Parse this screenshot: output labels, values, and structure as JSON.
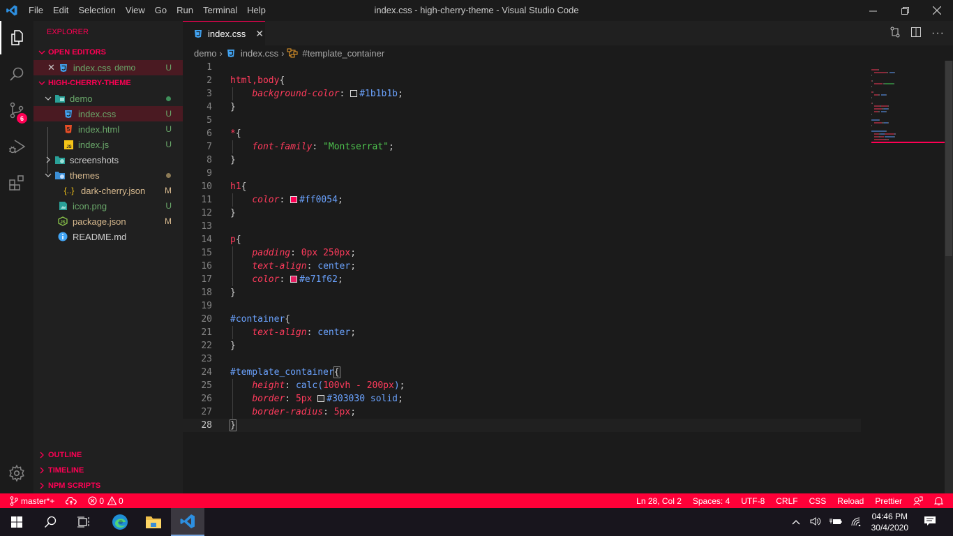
{
  "titlebar": {
    "menu": [
      "File",
      "Edit",
      "Selection",
      "View",
      "Go",
      "Run",
      "Terminal",
      "Help"
    ],
    "title": "index.css - high-cherry-theme - Visual Studio Code",
    "controls": [
      "minimize",
      "restore",
      "close"
    ]
  },
  "activity_bar": {
    "items": [
      {
        "name": "explorer",
        "active": true
      },
      {
        "name": "search"
      },
      {
        "name": "source-control",
        "badge": "6"
      },
      {
        "name": "run-debug"
      },
      {
        "name": "extensions"
      }
    ],
    "bottom": "manage"
  },
  "sidebar": {
    "title": "EXPLORER",
    "open_editors": {
      "label": "OPEN EDITORS",
      "items": [
        {
          "name": "index.css",
          "desc": "demo",
          "status": "U"
        }
      ]
    },
    "project": {
      "label": "HIGH-CHERRY-THEME",
      "tree": [
        {
          "name": "demo",
          "type": "folder",
          "expanded": true,
          "depth": 0,
          "dot": "#3f8f5a"
        },
        {
          "name": "index.css",
          "type": "css",
          "depth": 1,
          "status": "U",
          "selected": true
        },
        {
          "name": "index.html",
          "type": "html",
          "depth": 1,
          "status": "U"
        },
        {
          "name": "index.js",
          "type": "js",
          "depth": 1,
          "status": "U"
        },
        {
          "name": "screenshots",
          "type": "folder",
          "expanded": false,
          "depth": 0
        },
        {
          "name": "themes",
          "type": "folder",
          "expanded": true,
          "depth": 0,
          "dot": "#8c7a55"
        },
        {
          "name": "dark-cherry.json",
          "type": "json",
          "depth": 1,
          "status": "M"
        },
        {
          "name": "icon.png",
          "type": "png",
          "depth": 0,
          "status": "U"
        },
        {
          "name": "package.json",
          "type": "npm",
          "depth": 0,
          "status": "M"
        },
        {
          "name": "README.md",
          "type": "info",
          "depth": 0
        }
      ]
    },
    "bottom_sections": [
      "OUTLINE",
      "TIMELINE",
      "NPM SCRIPTS"
    ]
  },
  "tabs": [
    {
      "label": "index.css",
      "active": true
    }
  ],
  "breadcrumb": [
    "demo",
    "index.css",
    "#template_container"
  ],
  "editor": {
    "current_line": 28,
    "lines": [
      [],
      [
        [
          "sel",
          "html,body"
        ],
        [
          "punc",
          "{"
        ]
      ],
      [
        [
          "ind",
          "    "
        ],
        [
          "prop",
          "background-color"
        ],
        [
          "punc",
          ": "
        ],
        [
          "swatch",
          "#1b1b1b"
        ],
        [
          "val",
          "#1b1b1b"
        ],
        [
          "punc",
          ";"
        ]
      ],
      [
        [
          "punc",
          "}"
        ]
      ],
      [],
      [
        [
          "sel",
          "*"
        ],
        [
          "punc",
          "{"
        ]
      ],
      [
        [
          "ind",
          "    "
        ],
        [
          "prop",
          "font-family"
        ],
        [
          "punc",
          ": "
        ],
        [
          "str",
          "\"Montserrat\""
        ],
        [
          "punc",
          ";"
        ]
      ],
      [
        [
          "punc",
          "}"
        ]
      ],
      [],
      [
        [
          "sel",
          "h1"
        ],
        [
          "punc",
          "{"
        ]
      ],
      [
        [
          "ind",
          "    "
        ],
        [
          "prop",
          "color"
        ],
        [
          "punc",
          ": "
        ],
        [
          "swatch",
          "#ff0054"
        ],
        [
          "val",
          "#ff0054"
        ],
        [
          "punc",
          ";"
        ]
      ],
      [
        [
          "punc",
          "}"
        ]
      ],
      [],
      [
        [
          "sel",
          "p"
        ],
        [
          "punc",
          "{"
        ]
      ],
      [
        [
          "ind",
          "    "
        ],
        [
          "prop",
          "padding"
        ],
        [
          "punc",
          ": "
        ],
        [
          "num",
          "0px 250px"
        ],
        [
          "punc",
          ";"
        ]
      ],
      [
        [
          "ind",
          "    "
        ],
        [
          "prop",
          "text-align"
        ],
        [
          "punc",
          ": "
        ],
        [
          "val",
          "center"
        ],
        [
          "punc",
          ";"
        ]
      ],
      [
        [
          "ind",
          "    "
        ],
        [
          "prop",
          "color"
        ],
        [
          "punc",
          ": "
        ],
        [
          "swatch",
          "#e71f62"
        ],
        [
          "val",
          "#e71f62"
        ],
        [
          "punc",
          ";"
        ]
      ],
      [
        [
          "punc",
          "}"
        ]
      ],
      [],
      [
        [
          "idsel",
          "#container"
        ],
        [
          "punc",
          "{"
        ]
      ],
      [
        [
          "ind",
          "    "
        ],
        [
          "prop",
          "text-align"
        ],
        [
          "punc",
          ": "
        ],
        [
          "val",
          "center"
        ],
        [
          "punc",
          ";"
        ]
      ],
      [
        [
          "punc",
          "}"
        ]
      ],
      [],
      [
        [
          "idsel",
          "#template_container"
        ],
        [
          "match",
          "{"
        ]
      ],
      [
        [
          "ind",
          "    "
        ],
        [
          "prop",
          "height"
        ],
        [
          "punc",
          ": "
        ],
        [
          "val",
          "calc("
        ],
        [
          "num",
          "100vh - 200px"
        ],
        [
          "val",
          ")"
        ],
        [
          "punc",
          ";"
        ]
      ],
      [
        [
          "ind",
          "    "
        ],
        [
          "prop",
          "border"
        ],
        [
          "punc",
          ": "
        ],
        [
          "num",
          "5px "
        ],
        [
          "swatch",
          "#303030"
        ],
        [
          "val",
          "#303030 solid"
        ],
        [
          "punc",
          ";"
        ]
      ],
      [
        [
          "ind",
          "    "
        ],
        [
          "prop",
          "border-radius"
        ],
        [
          "punc",
          ": "
        ],
        [
          "num",
          "5px"
        ],
        [
          "punc",
          ";"
        ]
      ],
      [
        [
          "match",
          "}"
        ]
      ]
    ]
  },
  "statusbar": {
    "branch": "master*+",
    "errors": "0",
    "warnings": "0",
    "cursor": "Ln 28, Col 2",
    "spaces": "Spaces: 4",
    "encoding": "UTF-8",
    "eol": "CRLF",
    "language": "CSS",
    "reload": "Reload",
    "formatter": "Prettier"
  },
  "taskbar": {
    "time": "04:46 PM",
    "date": "30/4/2020"
  },
  "colors": {
    "accent": "#ff0054",
    "statusbar": "#ff0038",
    "background": "#1b1b1b"
  }
}
